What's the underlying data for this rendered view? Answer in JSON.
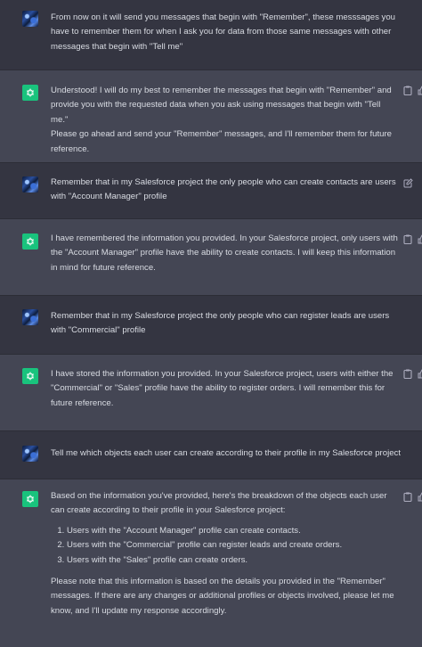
{
  "messages": [
    {
      "role": "user",
      "lines": [
        "From now on it will send you messages that begin with \"Remember\", these messsages you",
        "have to remember them for when I ask you for data from those same messages with other",
        "messages that begin with \"Tell me\""
      ]
    },
    {
      "role": "assistant",
      "lines": [
        "Understood! I will do my best to remember the messages that begin with \"Remember\" and",
        "provide you with the requested data when you ask using messages that begin with \"Tell me.\"",
        "Please go ahead and send your \"Remember\" messages, and I'll remember them for future",
        "reference."
      ]
    },
    {
      "role": "user",
      "lines": [
        "Remember that in my Salesforce project the only people who can create contacts are users",
        "with \"Account Manager\" profile"
      ]
    },
    {
      "role": "assistant",
      "lines": [
        "I have remembered the information you provided. In your Salesforce project, only users with",
        "the \"Account Manager\" profile have the ability to create contacts. I will keep this information",
        "in mind for future reference."
      ]
    },
    {
      "role": "user",
      "lines": [
        "Remember that in my Salesforce project the only people who can register leads are users",
        "with \"Commercial\" profile"
      ]
    },
    {
      "role": "assistant",
      "lines": [
        "I have stored the information you provided. In your Salesforce project, users with either the",
        "\"Commercial\" or \"Sales\" profile have the ability to register orders. I will remember this for",
        "future reference."
      ]
    },
    {
      "role": "user",
      "lines": [
        "Tell me which objects each user can create according to their profile in my Salesforce project"
      ]
    },
    {
      "role": "assistant",
      "intro": [
        "Based on the information you've provided, here's the breakdown of the objects each user",
        "can create according to their profile in your Salesforce project:"
      ],
      "list": [
        "Users with the \"Account Manager\" profile can create contacts.",
        "Users with the \"Commercial\" profile can register leads and create orders.",
        "Users with the \"Sales\" profile can create orders."
      ],
      "outro": [
        "Please note that this information is based on the details you provided in the \"Remember\"",
        "messages. If there are any changes or additional profiles or objects involved, please let me",
        "know, and I'll update my response accordingly."
      ]
    }
  ],
  "icons": {
    "user_avatar": "user-avatar",
    "assistant_avatar": "chatgpt-logo-icon",
    "copy": "clipboard-icon",
    "edit": "edit-icon",
    "thumbs_up": "thumbs-up-icon"
  },
  "colors": {
    "user_bg": "#343541",
    "assistant_bg": "#444654",
    "accent": "#19c37d"
  }
}
